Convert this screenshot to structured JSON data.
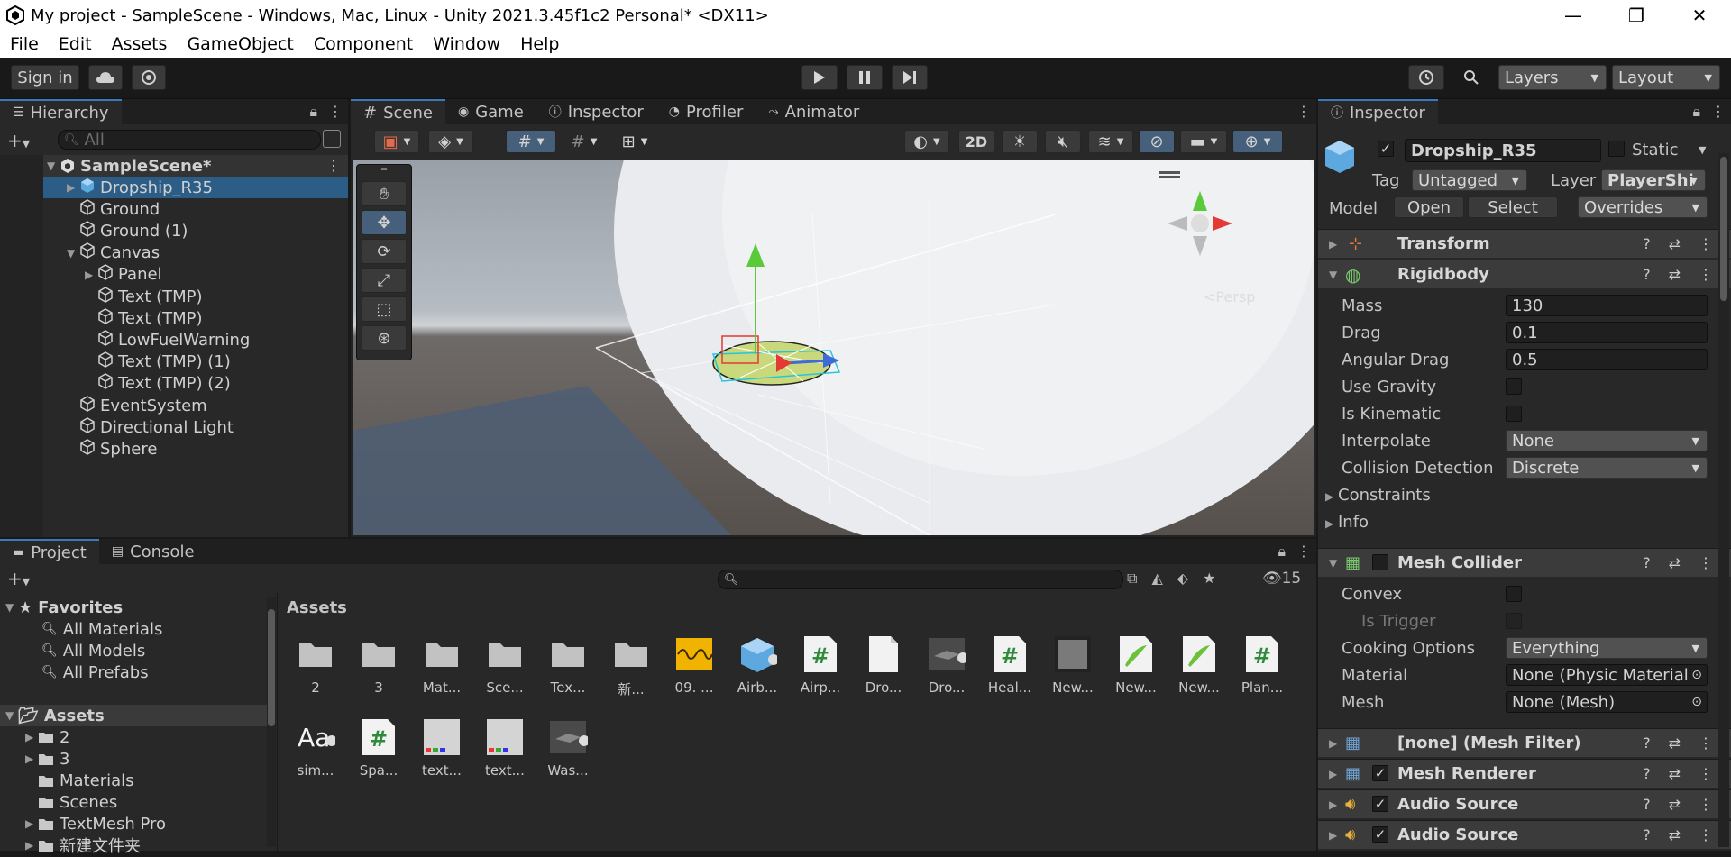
{
  "window": {
    "title": "My project - SampleScene - Windows, Mac, Linux - Unity 2021.3.45f1c2 Personal* <DX11>",
    "controls": [
      "—",
      "❐",
      "✕"
    ]
  },
  "menu": [
    "File",
    "Edit",
    "Assets",
    "GameObject",
    "Component",
    "Window",
    "Help"
  ],
  "toolbar": {
    "sign_in": "Sign in",
    "layers": "Layers",
    "layout": "Layout"
  },
  "hierarchy": {
    "tab": "Hierarchy",
    "search_placeholder": "All",
    "scene": "SampleScene*",
    "items": [
      {
        "label": "Dropship_R35",
        "depth": 1,
        "expand": true,
        "prefab": true
      },
      {
        "label": "Ground",
        "depth": 1,
        "expand": false
      },
      {
        "label": "Ground (1)",
        "depth": 1,
        "expand": false
      },
      {
        "label": "Canvas",
        "depth": 1,
        "expand": true,
        "open": true
      },
      {
        "label": "Panel",
        "depth": 2,
        "expand": true
      },
      {
        "label": "Text (TMP)",
        "depth": 2,
        "expand": false
      },
      {
        "label": "Text (TMP)",
        "depth": 2,
        "expand": false
      },
      {
        "label": "LowFuelWarning",
        "depth": 2,
        "expand": false
      },
      {
        "label": "Text (TMP) (1)",
        "depth": 2,
        "expand": false
      },
      {
        "label": "Text (TMP) (2)",
        "depth": 2,
        "expand": false
      },
      {
        "label": "EventSystem",
        "depth": 1,
        "expand": false
      },
      {
        "label": "Directional Light",
        "depth": 1,
        "expand": false
      },
      {
        "label": "Sphere",
        "depth": 1,
        "expand": false
      }
    ]
  },
  "center_tabs": [
    "Scene",
    "Game",
    "Inspector",
    "Profiler",
    "Animator"
  ],
  "scene_toolbar": {
    "mode_2d": "2D",
    "persp": "<Persp"
  },
  "project": {
    "tabs": [
      "Project",
      "Console"
    ],
    "hidden_count": "15",
    "breadcrumb": "Assets",
    "favorites_label": "Favorites",
    "favorites": [
      "All Materials",
      "All Models",
      "All Prefabs"
    ],
    "assets_label": "Assets",
    "asset_folders": [
      {
        "label": "2",
        "expand": true
      },
      {
        "label": "3",
        "expand": true
      },
      {
        "label": "Materials",
        "expand": false
      },
      {
        "label": "Scenes",
        "expand": false
      },
      {
        "label": "TextMesh Pro",
        "expand": true
      },
      {
        "label": "新建文件夹",
        "expand": true
      }
    ],
    "grid": [
      {
        "label": "2",
        "kind": "folder"
      },
      {
        "label": "3",
        "kind": "folder"
      },
      {
        "label": "Mat...",
        "kind": "folder"
      },
      {
        "label": "Sce...",
        "kind": "folder"
      },
      {
        "label": "Tex...",
        "kind": "folder"
      },
      {
        "label": "新...",
        "kind": "folder"
      },
      {
        "label": "09. ...",
        "kind": "audio"
      },
      {
        "label": "Airb...",
        "kind": "prefab"
      },
      {
        "label": "Airp...",
        "kind": "script"
      },
      {
        "label": "Dro...",
        "kind": "file"
      },
      {
        "label": "Dro...",
        "kind": "model"
      },
      {
        "label": "Heal...",
        "kind": "script"
      },
      {
        "label": "New...",
        "kind": "material"
      },
      {
        "label": "New...",
        "kind": "physics"
      },
      {
        "label": "New...",
        "kind": "physics"
      },
      {
        "label": "Plan...",
        "kind": "script"
      },
      {
        "label": "sim...",
        "kind": "font"
      },
      {
        "label": "Spa...",
        "kind": "script"
      },
      {
        "label": "text...",
        "kind": "texture"
      },
      {
        "label": "text...",
        "kind": "texture"
      },
      {
        "label": "Was...",
        "kind": "model"
      }
    ]
  },
  "inspector": {
    "tab": "Inspector",
    "object_name": "Dropship_R35",
    "static_label": "Static",
    "tag_label": "Tag",
    "tag_value": "Untagged",
    "layer_label": "Layer",
    "layer_value": "PlayerShi",
    "model_label": "Model",
    "open": "Open",
    "select": "Select",
    "overrides": "Overrides",
    "transform": "Transform",
    "rigidbody": {
      "title": "Rigidbody",
      "mass_label": "Mass",
      "mass": "130",
      "drag_label": "Drag",
      "drag": "0.1",
      "angular_drag_label": "Angular Drag",
      "angular_drag": "0.5",
      "use_gravity_label": "Use Gravity",
      "is_kinematic_label": "Is Kinematic",
      "interpolate_label": "Interpolate",
      "interpolate": "None",
      "collision_label": "Collision Detection",
      "collision": "Discrete",
      "constraints": "Constraints",
      "info": "Info"
    },
    "mesh_collider": {
      "title": "Mesh Collider",
      "convex_label": "Convex",
      "is_trigger_label": "Is Trigger",
      "cooking_label": "Cooking Options",
      "cooking": "Everything",
      "material_label": "Material",
      "material": "None (Physic Material",
      "mesh_label": "Mesh",
      "mesh": "None (Mesh)"
    },
    "mesh_filter": "[none] (Mesh Filter)",
    "mesh_renderer": "Mesh Renderer",
    "audio_source_1": "Audio Source",
    "audio_source_2": "Audio Source"
  }
}
